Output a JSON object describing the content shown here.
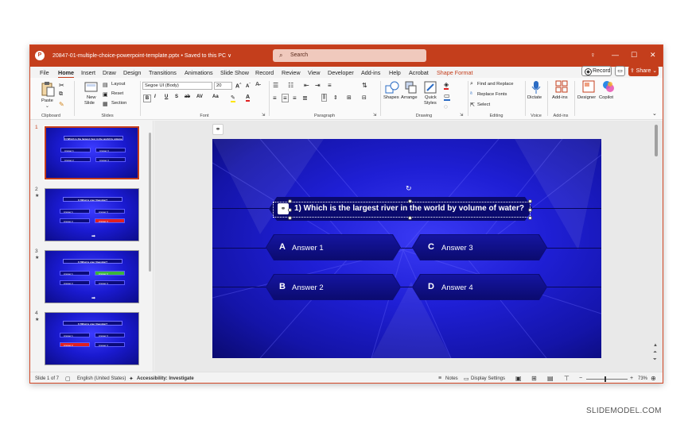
{
  "titlebar": {
    "app_logo": "P",
    "document": "20847-01-multiple-choice-powerpoint-template.pptx • Saved to this PC ∨",
    "search_placeholder": "Search",
    "colors": {
      "accent": "#c43e1c"
    }
  },
  "menu": {
    "tabs": [
      "File",
      "Home",
      "Insert",
      "Draw",
      "Design",
      "Transitions",
      "Animations",
      "Slide Show",
      "Record",
      "Review",
      "View",
      "Developer",
      "Add-ins",
      "Help",
      "Acrobat",
      "Shape Format"
    ],
    "active": "Home",
    "record_label": "Record",
    "share_label": "Share"
  },
  "ribbon": {
    "clipboard": {
      "paste": "Paste",
      "label": "Clipboard"
    },
    "slides": {
      "new_slide": "New",
      "new_slide2": "Slide",
      "layout": "Layout",
      "reset": "Reset",
      "section": "Section",
      "label": "Slides"
    },
    "font": {
      "name": "Segoe UI (Body)",
      "size": "20",
      "label": "Font"
    },
    "paragraph": {
      "label": "Paragraph"
    },
    "drawing": {
      "shapes": "Shapes",
      "arrange": "Arrange",
      "quick_styles": "Quick",
      "quick_styles2": "Styles",
      "label": "Drawing"
    },
    "editing": {
      "find_replace": "Find and Replace",
      "replace_fonts": "Replace Fonts",
      "select": "Select",
      "label": "Editing"
    },
    "voice": {
      "dictate": "Dictate",
      "label": "Voice"
    },
    "addins": {
      "addins": "Add-ins",
      "label": "Add-ins"
    },
    "designer": "Designer",
    "copilot": "Copilot"
  },
  "thumbnails": [
    {
      "num": "1",
      "question": "1) Which is the largest river in the world by volume of water?",
      "answers": [
        "Answer 1",
        "Answer 3",
        "Answer 2",
        "Answer 4"
      ],
      "highlight": "none",
      "starred": false
    },
    {
      "num": "2",
      "question": "1) What is your Question?",
      "answers": [
        "Answer 1",
        "Answer 3",
        "Answer 2",
        "Answer 4"
      ],
      "highlight": "red",
      "starred": true
    },
    {
      "num": "3",
      "question": "1) What is your Question?",
      "answers": [
        "Answer 1",
        "Answer 3",
        "Answer 2",
        "Answer 4"
      ],
      "highlight": "green",
      "starred": true
    },
    {
      "num": "4",
      "question": "1) What is your Question?",
      "answers": [
        "Answer 1",
        "Answer 3",
        "Answer 2",
        "Answer 4"
      ],
      "highlight": "red-left",
      "starred": true
    }
  ],
  "slide": {
    "question": "1) Which is the largest river in the world by volume of water?",
    "answers": [
      {
        "letter": "A",
        "text": "Answer 1"
      },
      {
        "letter": "C",
        "text": "Answer 3"
      },
      {
        "letter": "B",
        "text": "Answer 2"
      },
      {
        "letter": "D",
        "text": "Answer 4"
      }
    ],
    "colors": {
      "background": "#1f1fd5",
      "box": "#0c0c78"
    }
  },
  "status": {
    "slide_of": "Slide 1 of 7",
    "language": "English (United States)",
    "accessibility": "Accessibility: Investigate",
    "notes": "Notes",
    "display": "Display Settings",
    "zoom": "73%"
  },
  "watermark": "SLIDEMODEL.COM"
}
